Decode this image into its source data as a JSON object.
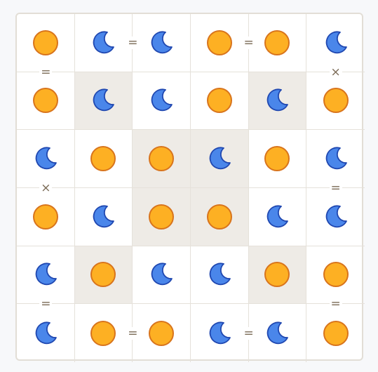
{
  "board": {
    "size": 6,
    "cells": [
      [
        "sun",
        "moon",
        "moon",
        "sun",
        "sun",
        "moon"
      ],
      [
        "sun",
        "moon",
        "moon",
        "sun",
        "moon",
        "sun"
      ],
      [
        "moon",
        "sun",
        "sun",
        "moon",
        "sun",
        "moon"
      ],
      [
        "sun",
        "moon",
        "sun",
        "sun",
        "moon",
        "moon"
      ],
      [
        "moon",
        "sun",
        "moon",
        "moon",
        "sun",
        "sun"
      ],
      [
        "moon",
        "sun",
        "sun",
        "moon",
        "moon",
        "sun"
      ]
    ],
    "prefilled": [
      [
        false,
        false,
        false,
        false,
        false,
        false
      ],
      [
        false,
        true,
        false,
        false,
        true,
        false
      ],
      [
        false,
        false,
        true,
        true,
        false,
        false
      ],
      [
        false,
        false,
        true,
        true,
        false,
        false
      ],
      [
        false,
        true,
        false,
        false,
        true,
        false
      ],
      [
        false,
        false,
        false,
        false,
        false,
        false
      ]
    ],
    "constraints": [
      {
        "row": 0,
        "col": 1,
        "dir": "h",
        "symbol": "="
      },
      {
        "row": 0,
        "col": 3,
        "dir": "h",
        "symbol": "="
      },
      {
        "row": 0,
        "col": 0,
        "dir": "v",
        "symbol": "="
      },
      {
        "row": 0,
        "col": 5,
        "dir": "v",
        "symbol": "×"
      },
      {
        "row": 2,
        "col": 0,
        "dir": "v",
        "symbol": "×"
      },
      {
        "row": 2,
        "col": 5,
        "dir": "v",
        "symbol": "="
      },
      {
        "row": 4,
        "col": 0,
        "dir": "v",
        "symbol": "="
      },
      {
        "row": 4,
        "col": 5,
        "dir": "v",
        "symbol": "="
      },
      {
        "row": 5,
        "col": 1,
        "dir": "h",
        "symbol": "="
      },
      {
        "row": 5,
        "col": 3,
        "dir": "h",
        "symbol": "="
      }
    ]
  },
  "colors": {
    "sun_fill": "#fdb023",
    "sun_stroke": "#d8741c",
    "moon_fill": "#4a86ea",
    "moon_stroke": "#1f47b0",
    "prefilled_bg": "#eeebe6",
    "constraint_color": "#7a6a55"
  },
  "icons": {
    "sun": "sun-icon",
    "moon": "moon-icon"
  }
}
